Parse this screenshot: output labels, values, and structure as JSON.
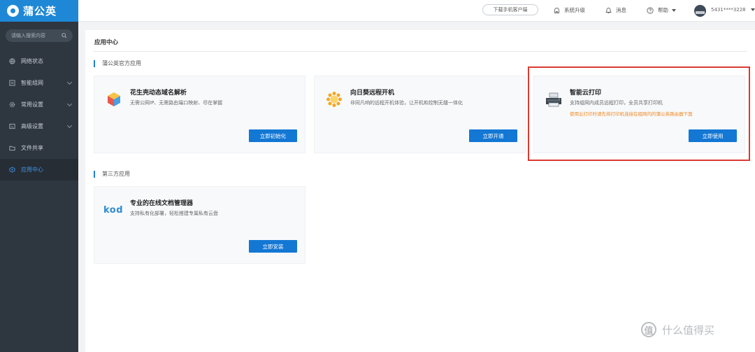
{
  "app": {
    "logo_text": "蒲公英"
  },
  "sidebar": {
    "search_placeholder": "请输入搜索内容",
    "items": [
      {
        "label": "网络状态",
        "icon": "globe-icon",
        "has_submenu": false,
        "active": false
      },
      {
        "label": "智能组网",
        "icon": "network-icon",
        "has_submenu": true,
        "active": false
      },
      {
        "label": "常用设置",
        "icon": "gear-icon",
        "has_submenu": true,
        "active": false
      },
      {
        "label": "高级设置",
        "icon": "settings-panel-icon",
        "has_submenu": true,
        "active": false
      },
      {
        "label": "文件共享",
        "icon": "folder-icon",
        "has_submenu": false,
        "active": false
      },
      {
        "label": "应用中心",
        "icon": "apps-icon",
        "has_submenu": false,
        "active": true
      }
    ]
  },
  "header": {
    "download_label": "下载手机客户端",
    "upgrade_label": "系统升级",
    "messages_label": "消息",
    "help_label": "帮助",
    "user_label": "5431****3228"
  },
  "main": {
    "page_title": "应用中心",
    "sections": [
      {
        "title": "蒲公英官方应用",
        "cards": [
          {
            "name": "花生壳动态域名解析",
            "desc": "无需公网IP、无需路由端口映射、尽在掌握",
            "note": "",
            "button": "立即初始化",
            "icon": "cube-icon"
          },
          {
            "name": "向日葵远程开机",
            "desc": "非同凡响的远程开机体验，让开机和控制无缝一体化",
            "note": "",
            "button": "立即开通",
            "icon": "sunflower-icon"
          },
          {
            "name": "智能云打印",
            "desc": "支持组网内成员远程打印，全员共享打印机",
            "note": "使用云打印时请先将打印机连接在组网内的蒲公英路由器下面",
            "button": "立即使用",
            "icon": "printer-icon"
          }
        ]
      },
      {
        "title": "第三方应用",
        "cards": [
          {
            "name": "专业的在线文档管理器",
            "desc": "支持私有化部署，轻松搭建专属私有云盘",
            "note": "",
            "button": "立即安装",
            "icon": "kod-logo",
            "logo_text": "kod"
          }
        ]
      }
    ]
  },
  "watermark": {
    "circle_text": "值",
    "text": "什么值得买"
  },
  "colors": {
    "accent": "#1377d4",
    "sidebar_bg": "#2e3640",
    "logo_bg": "#1e88d6",
    "highlight": "#d93a32",
    "note": "#f08a24"
  }
}
